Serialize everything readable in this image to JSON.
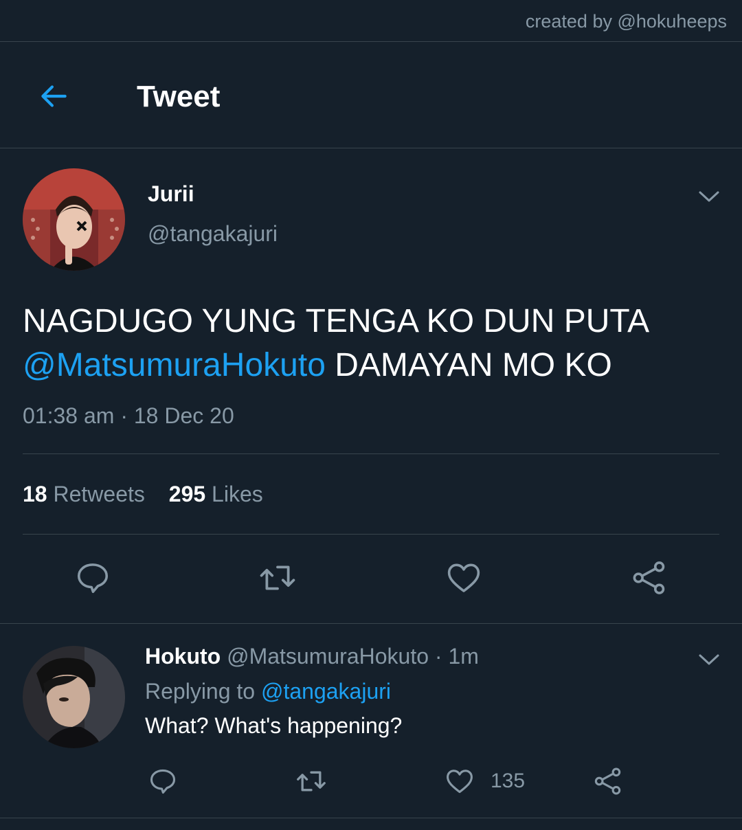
{
  "watermark": "created by @hokuheeps",
  "header": {
    "back_icon": "arrow-left-icon",
    "title": "Tweet"
  },
  "tweet": {
    "author_name": "Jurii",
    "author_handle": "@tangakajuri",
    "text_line1": "NAGDUGO YUNG TENGA KO DUN PUTA",
    "mention": "@MatsumuraHokuto",
    "text_line2_rest": " DAMAYAN MO KO",
    "timestamp": "01:38 am · 18 Dec 20",
    "retweet_count": "18",
    "retweet_label": "Retweets",
    "like_count": "295",
    "like_label": "Likes",
    "actions": [
      "reply-icon",
      "retweet-icon",
      "heart-icon",
      "share-icon"
    ]
  },
  "reply": {
    "author_name": "Hokuto",
    "author_handle": "@MatsumuraHokuto",
    "time_ago": "· 1m",
    "replying_to_label": "Replying to",
    "replying_to_handle": "@tangakajuri",
    "text": "What? What's happening?",
    "like_count": "135"
  },
  "colors": {
    "background": "#15202b",
    "accent": "#1da1f2",
    "muted": "#8899a6",
    "divider": "#38444d"
  }
}
